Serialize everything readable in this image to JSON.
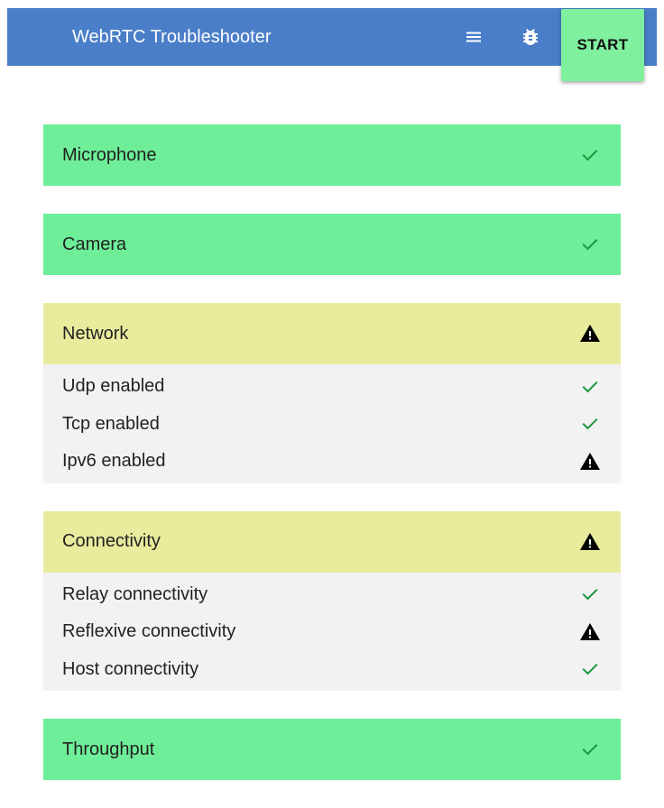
{
  "app": {
    "title": "WebRTC Troubleshooter",
    "start_label": "START",
    "menu_icon": "menu-icon",
    "bug_icon": "bug-icon"
  },
  "colors": {
    "appbar": "#4a7ec9",
    "success": "#6eee98",
    "warning": "#e8ec9c",
    "check": "#1a9641",
    "sublist": "#f2f2f2"
  },
  "tests": [
    {
      "title": "Microphone",
      "status": "success",
      "subtests": []
    },
    {
      "title": "Camera",
      "status": "success",
      "subtests": []
    },
    {
      "title": "Network",
      "status": "warning",
      "subtests": [
        {
          "label": "Udp enabled",
          "status": "success"
        },
        {
          "label": "Tcp enabled",
          "status": "success"
        },
        {
          "label": "Ipv6 enabled",
          "status": "warning"
        }
      ]
    },
    {
      "title": "Connectivity",
      "status": "warning",
      "subtests": [
        {
          "label": "Relay connectivity",
          "status": "success"
        },
        {
          "label": "Reflexive connectivity",
          "status": "warning"
        },
        {
          "label": "Host connectivity",
          "status": "success"
        }
      ]
    },
    {
      "title": "Throughput",
      "status": "success",
      "subtests": []
    }
  ]
}
